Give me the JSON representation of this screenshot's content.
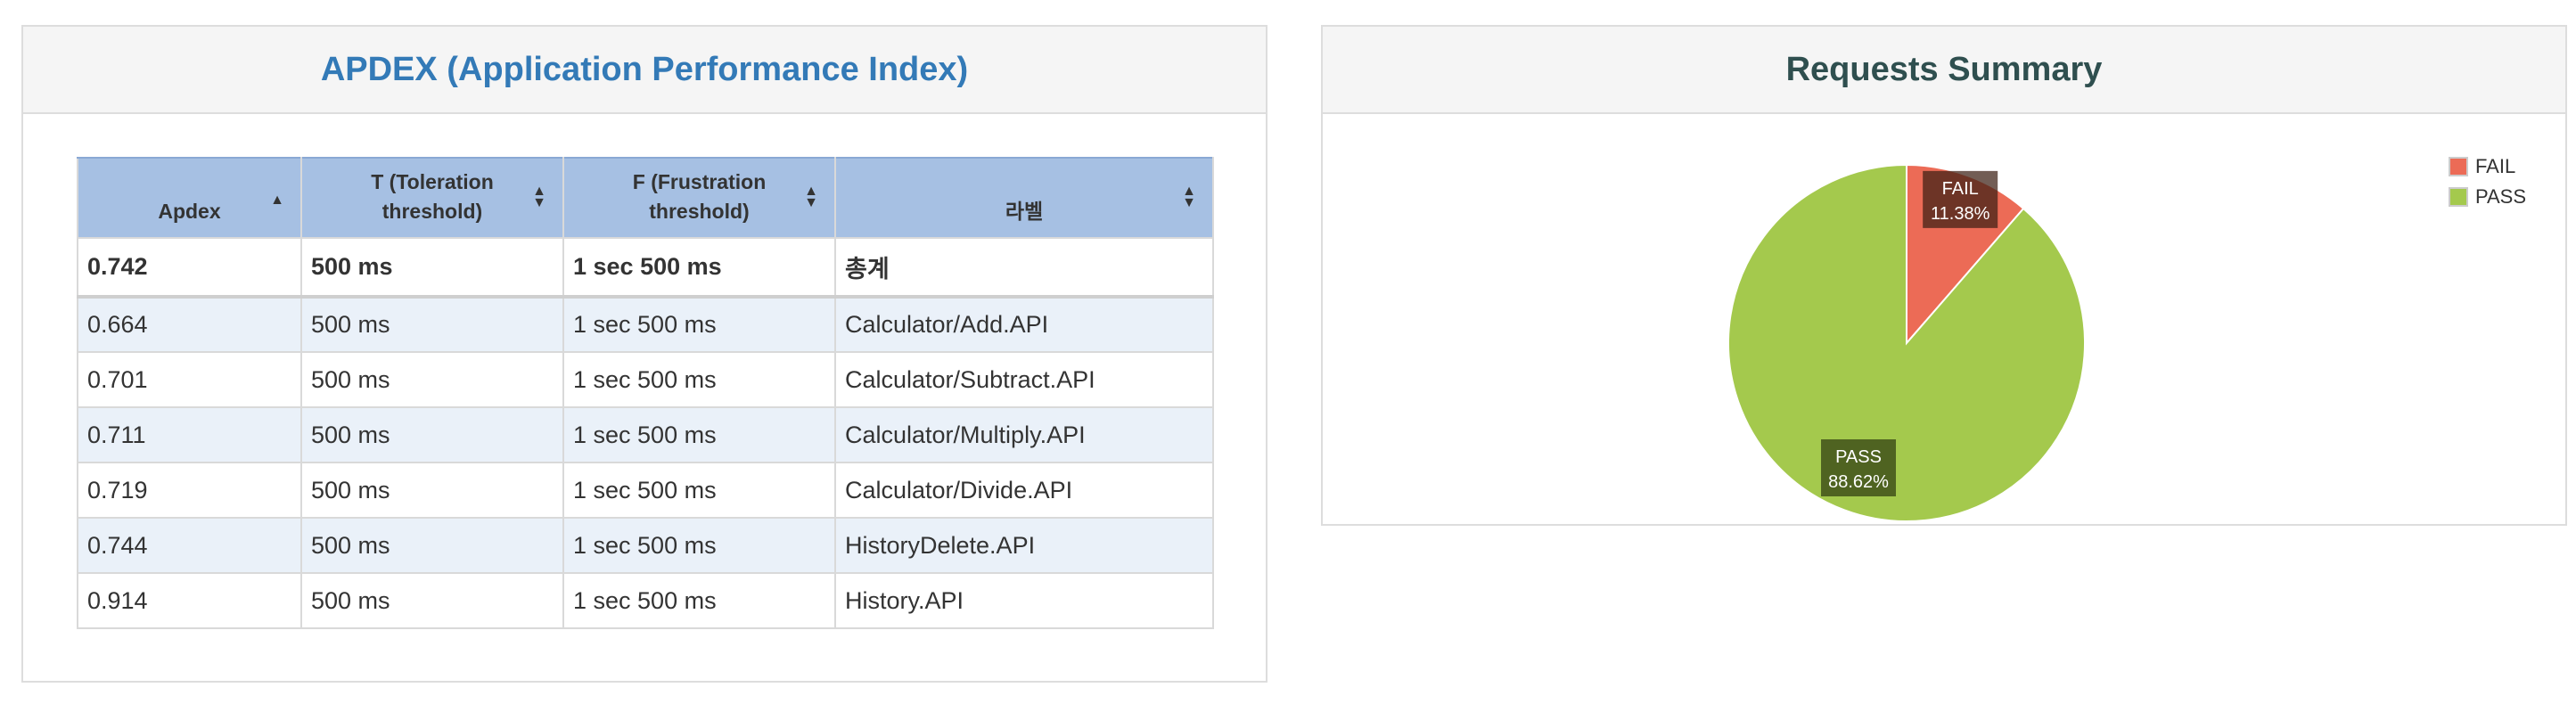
{
  "apdex": {
    "title": "APDEX (Application Performance Index)",
    "columns": [
      "Apdex",
      "T (Toleration threshold)",
      "F (Frustration threshold)",
      "라벨"
    ],
    "rows": [
      {
        "apdex": "0.742",
        "t": "500 ms",
        "f": "1 sec 500 ms",
        "label": "총계"
      },
      {
        "apdex": "0.664",
        "t": "500 ms",
        "f": "1 sec 500 ms",
        "label": "Calculator/Add.API"
      },
      {
        "apdex": "0.701",
        "t": "500 ms",
        "f": "1 sec 500 ms",
        "label": "Calculator/Subtract.API"
      },
      {
        "apdex": "0.711",
        "t": "500 ms",
        "f": "1 sec 500 ms",
        "label": "Calculator/Multiply.API"
      },
      {
        "apdex": "0.719",
        "t": "500 ms",
        "f": "1 sec 500 ms",
        "label": "Calculator/Divide.API"
      },
      {
        "apdex": "0.744",
        "t": "500 ms",
        "f": "1 sec 500 ms",
        "label": "HistoryDelete.API"
      },
      {
        "apdex": "0.914",
        "t": "500 ms",
        "f": "1 sec 500 ms",
        "label": "History.API"
      }
    ]
  },
  "summary": {
    "title": "Requests Summary"
  },
  "chart_data": {
    "type": "pie",
    "slices": [
      {
        "name": "FAIL",
        "value": 11.38,
        "label": "11.38%",
        "color": "#ec6b56"
      },
      {
        "name": "PASS",
        "value": 88.62,
        "label": "88.62%",
        "color": "#a4c94d"
      }
    ],
    "legend": "top-right"
  }
}
